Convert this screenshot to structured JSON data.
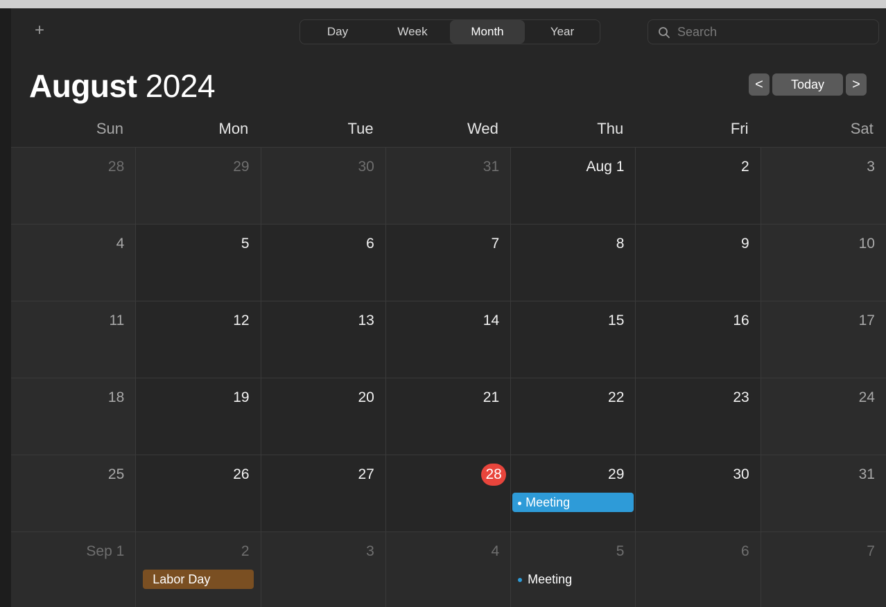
{
  "toolbar": {
    "add_label": "+",
    "views": [
      "Day",
      "Week",
      "Month",
      "Year"
    ],
    "active_view": "Month",
    "search_placeholder": "Search"
  },
  "header": {
    "month": "August",
    "year": "2024",
    "prev_label": "<",
    "today_label": "Today",
    "next_label": ">"
  },
  "weekdays": [
    "Sun",
    "Mon",
    "Tue",
    "Wed",
    "Thu",
    "Fri",
    "Sat"
  ],
  "weeks": [
    [
      "28",
      "29",
      "30",
      "31",
      "Aug 1",
      "2",
      "3"
    ],
    [
      "4",
      "5",
      "6",
      "7",
      "8",
      "9",
      "10"
    ],
    [
      "11",
      "12",
      "13",
      "14",
      "15",
      "16",
      "17"
    ],
    [
      "18",
      "19",
      "20",
      "21",
      "22",
      "23",
      "24"
    ],
    [
      "25",
      "26",
      "27",
      "28",
      "29",
      "30",
      "31"
    ],
    [
      "Sep 1",
      "2",
      "3",
      "4",
      "5",
      "6",
      "7"
    ]
  ],
  "today_date": "28",
  "events": {
    "aug29": "Meeting",
    "sep2": "Labor Day",
    "sep5": "Meeting"
  },
  "colors": {
    "today": "#e8453c",
    "meeting": "#2e9bd8",
    "holiday": "#7a4f22"
  }
}
